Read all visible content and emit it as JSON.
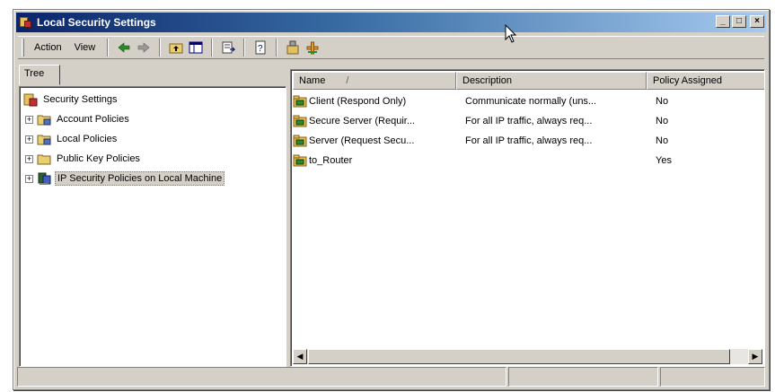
{
  "window": {
    "title": "Local Security Settings",
    "minimize_label": "_",
    "maximize_label": "□",
    "close_label": "×"
  },
  "toolbar": {
    "action_menu": "Action",
    "view_menu": "View",
    "buttons": [
      "back-icon",
      "forward-icon",
      "up-folder-icon",
      "show-hide-tree-icon",
      "export-list-icon",
      "help-icon",
      "manage-ip-filters-icon",
      "add-policy-icon"
    ]
  },
  "tree": {
    "tab_label": "Tree",
    "root": "Security Settings",
    "items": [
      {
        "label": "Account Policies",
        "expander": "+"
      },
      {
        "label": "Local Policies",
        "expander": "+"
      },
      {
        "label": "Public Key Policies",
        "expander": "+"
      },
      {
        "label": "IP Security Policies on Local Machine",
        "expander": "+",
        "selected": true
      }
    ]
  },
  "list": {
    "columns": {
      "name": "Name",
      "sort_indicator": "/",
      "description": "Description",
      "policy_assigned": "Policy Assigned"
    },
    "rows": [
      {
        "name": "Client (Respond Only)",
        "description": "Communicate normally (uns...",
        "assigned": "No"
      },
      {
        "name": "Secure Server (Requir...",
        "description": "For all IP traffic, always req...",
        "assigned": "No"
      },
      {
        "name": "Server (Request Secu...",
        "description": "For all IP traffic, always req...",
        "assigned": "No"
      },
      {
        "name": "to_Router",
        "description": "",
        "assigned": "Yes"
      }
    ],
    "scroll_left": "◀",
    "scroll_right": "▶"
  },
  "colors": {
    "title_start": "#0a246a",
    "title_end": "#a6caf0",
    "face": "#d4d0c8",
    "shadow": "#808080"
  }
}
